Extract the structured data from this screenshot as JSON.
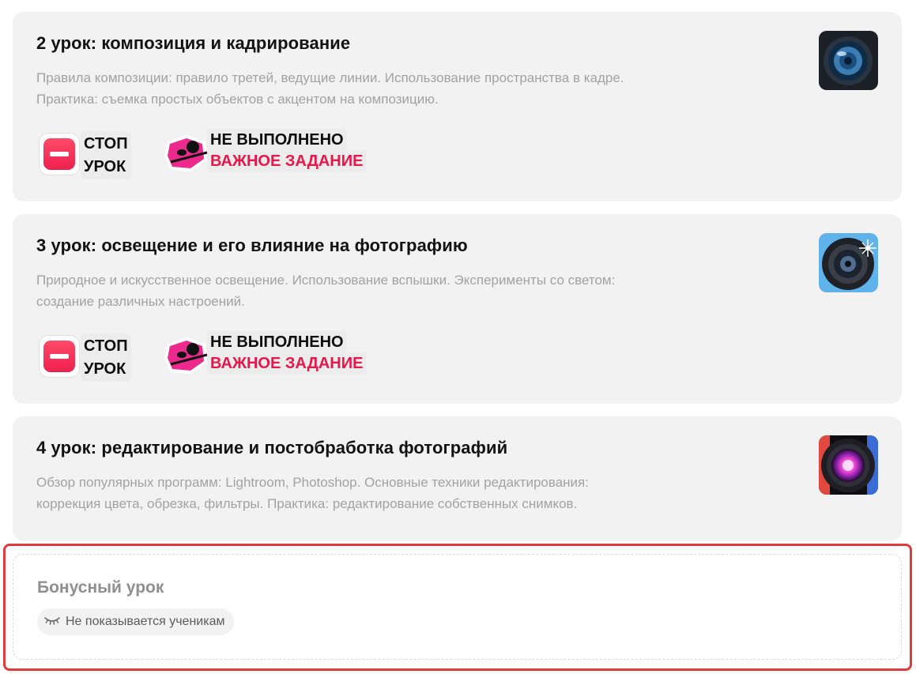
{
  "lessons": [
    {
      "title": "2 урок: композиция и кадрирование",
      "desc_line1": "Правила композиции: правило третей, ведущие линии. Использование пространства в кадре.",
      "desc_line2": "Практика: съемка простых объектов с акцентом на композицию.",
      "icon": "camera-lens-icon",
      "stop_line1": "СТОП",
      "stop_line2": "УРОК",
      "status": "НЕ ВЫПОЛНЕНО",
      "task_type": "ВАЖНОЕ ЗАДАНИЕ"
    },
    {
      "title": "3 урок: освещение и его влияние на фотографию",
      "desc_line1": "Природное и искусственное освещение. Использование вспышки. Эксперименты со светом:",
      "desc_line2": "создание различных настроений.",
      "icon": "camera-lens-flash-icon",
      "stop_line1": "СТОП",
      "stop_line2": "УРОК",
      "status": "НЕ ВЫПОЛНЕНО",
      "task_type": "ВАЖНОЕ ЗАДАНИЕ"
    },
    {
      "title": "4 урок: редактирование и постобработка фотографий",
      "desc_line1": "Обзор популярных программ: Lightroom, Photoshop. Основные техники редактирования:",
      "desc_line2": "коррекция цвета, обрезка, фильтры. Практика: редактирование собственных снимков.",
      "icon": "colorful-lens-icon"
    }
  ],
  "bonus": {
    "title": "Бонусный урок",
    "visibility": "Не показывается ученикам",
    "icon": "eye-closed-icon"
  },
  "colors": {
    "card_bg": "#f2f2f2",
    "accent_red": "#e8174a",
    "highlight_border": "#e23a3a"
  }
}
